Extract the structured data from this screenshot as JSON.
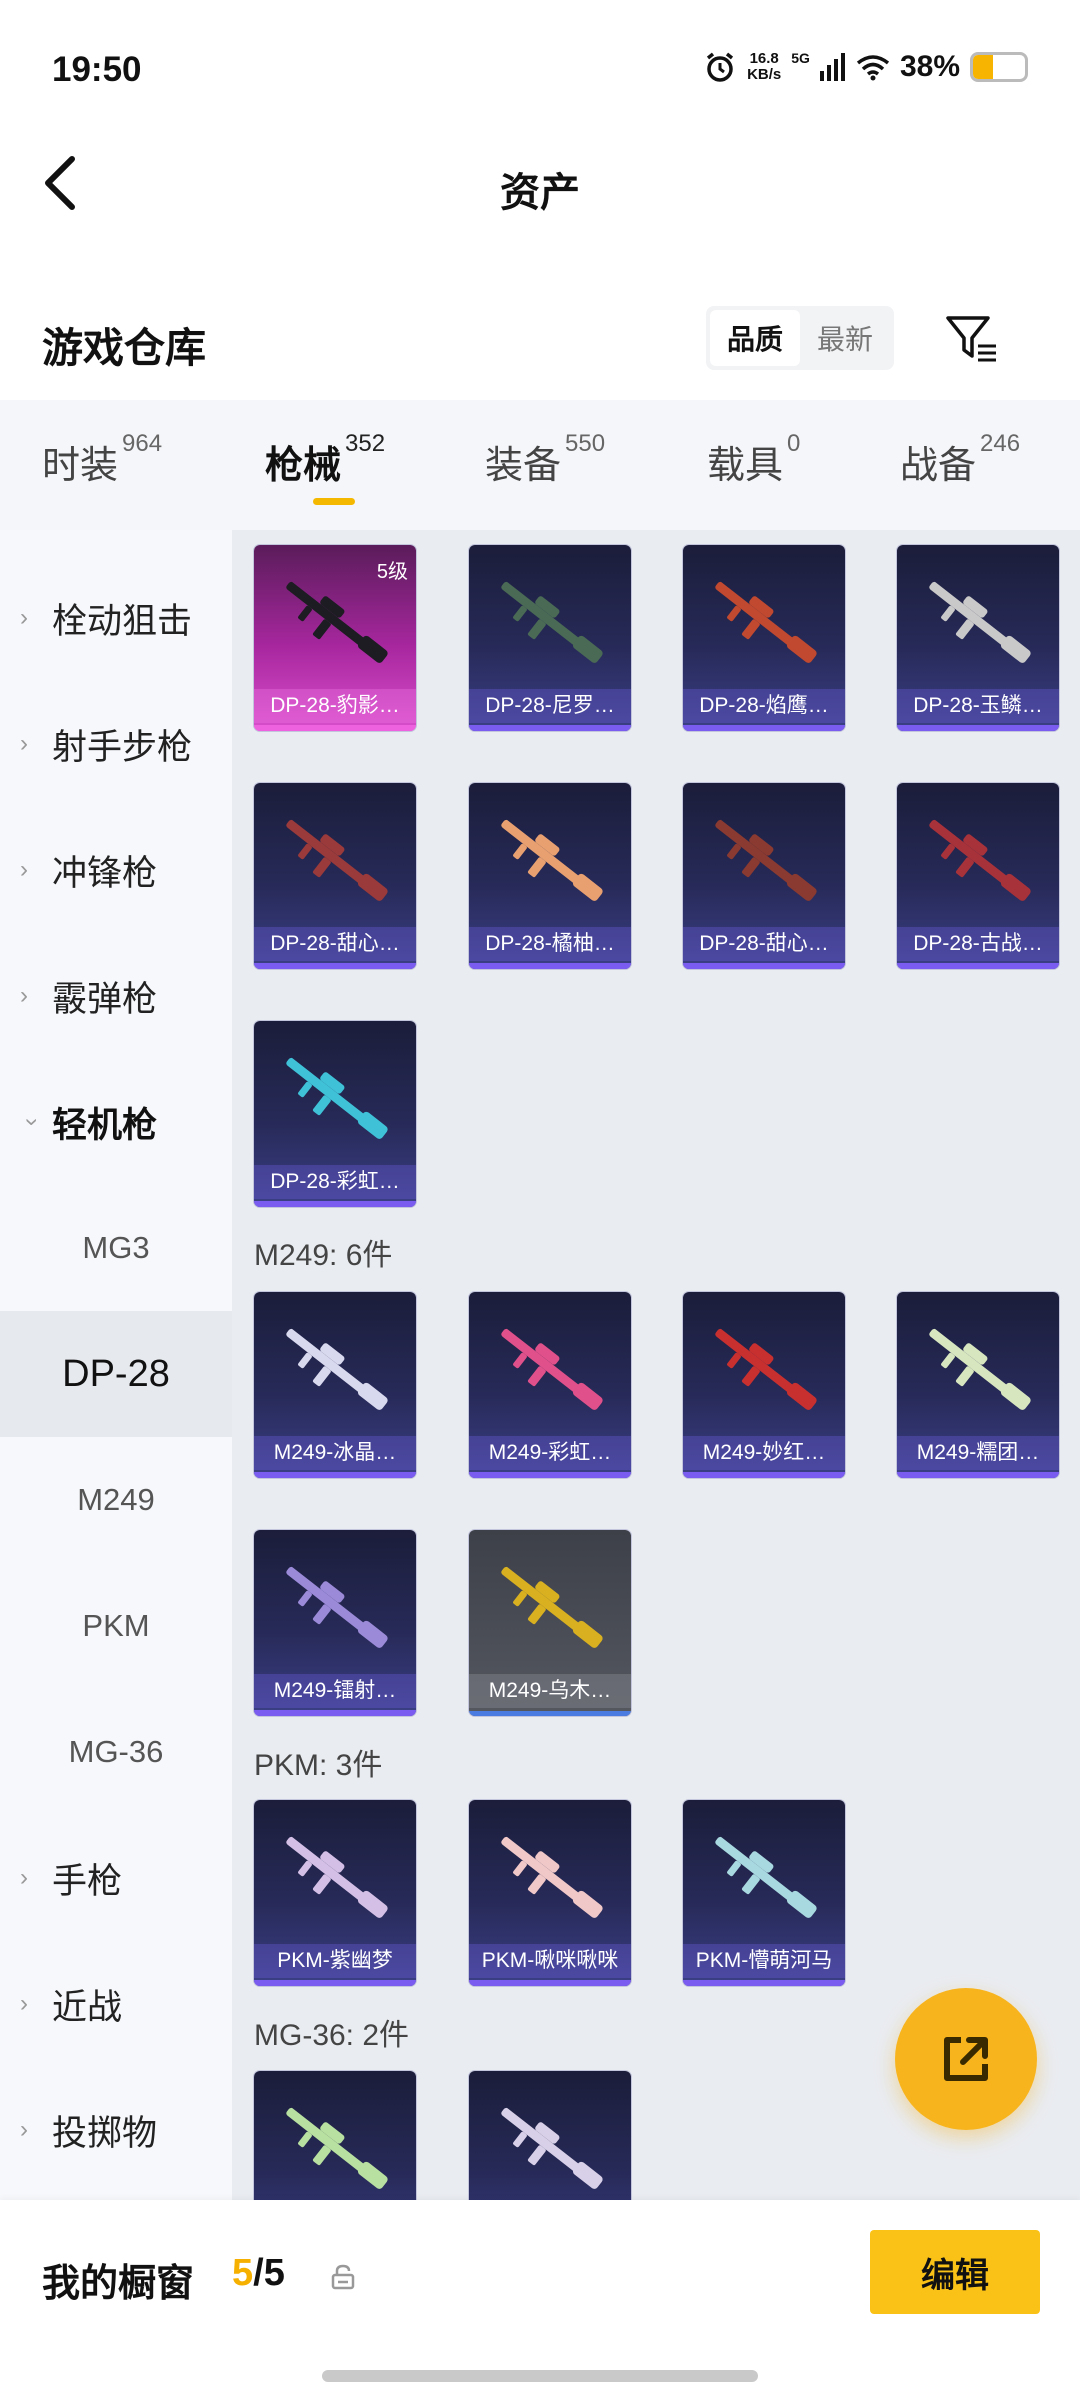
{
  "status_bar": {
    "time": "19:50",
    "speed_value": "16.8",
    "speed_unit": "KB/s",
    "network": "5G",
    "battery_percent": "38%",
    "battery_level": 0.38
  },
  "header": {
    "title": "资产"
  },
  "warehouse": {
    "title": "游戏仓库",
    "sort_options": [
      "品质",
      "最新"
    ],
    "sort_selected": "品质"
  },
  "tabs": [
    {
      "label": "时装",
      "count": "964"
    },
    {
      "label": "枪械",
      "count": "352",
      "active": true
    },
    {
      "label": "装备",
      "count": "550"
    },
    {
      "label": "载具",
      "count": "0"
    },
    {
      "label": "战备",
      "count": "246"
    }
  ],
  "sidebar": {
    "categories": [
      {
        "label": "栓动狙击"
      },
      {
        "label": "射手步枪"
      },
      {
        "label": "冲锋枪"
      },
      {
        "label": "霰弹枪"
      },
      {
        "label": "轻机枪",
        "expanded": true
      }
    ],
    "subitems": [
      {
        "label": "MG3"
      },
      {
        "label": "DP-28",
        "active": true
      },
      {
        "label": "M249"
      },
      {
        "label": "PKM"
      },
      {
        "label": "MG-36"
      }
    ],
    "more_categories": [
      {
        "label": "手枪"
      },
      {
        "label": "近战"
      },
      {
        "label": "投掷物"
      }
    ]
  },
  "groups": [
    {
      "heading": "",
      "items": [
        {
          "name": "DP-28-豹影…",
          "badge": "5级",
          "style": "pink",
          "gun_color": "#1c1c22"
        },
        {
          "name": "DP-28-尼罗…",
          "style": "purple",
          "gun_color": "#4a6a55"
        },
        {
          "name": "DP-28-焰鹰…",
          "style": "purple",
          "gun_color": "#c0492f"
        },
        {
          "name": "DP-28-玉鳞…",
          "style": "purple",
          "gun_color": "#c9c9c9"
        },
        {
          "name": "DP-28-甜心…",
          "style": "purple",
          "gun_color": "#9a3a3a"
        },
        {
          "name": "DP-28-橘柚…",
          "style": "purple",
          "gun_color": "#e8a070"
        },
        {
          "name": "DP-28-甜心…",
          "style": "purple",
          "gun_color": "#8a3a30"
        },
        {
          "name": "DP-28-古战…",
          "style": "purple",
          "gun_color": "#a8323a"
        },
        {
          "name": "DP-28-彩虹…",
          "style": "purple",
          "gun_color": "#3fc2d8"
        }
      ]
    },
    {
      "heading": "M249: 6件",
      "items": [
        {
          "name": "M249-冰晶…",
          "style": "purple",
          "gun_color": "#d8d8ee"
        },
        {
          "name": "M249-彩虹…",
          "style": "purple",
          "gun_color": "#e0508a"
        },
        {
          "name": "M249-妙红…",
          "style": "purple",
          "gun_color": "#c83030"
        },
        {
          "name": "M249-糯团…",
          "style": "purple",
          "gun_color": "#d8e6c0"
        },
        {
          "name": "M249-镭射…",
          "style": "purple",
          "gun_color": "#9a8ad8"
        },
        {
          "name": "M249-乌木…",
          "style": "grey",
          "gun_color": "#d8b020"
        }
      ]
    },
    {
      "heading": "PKM: 3件",
      "items": [
        {
          "name": "PKM-紫幽梦",
          "style": "purple",
          "gun_color": "#d4c0e6"
        },
        {
          "name": "PKM-啾咪啾咪",
          "style": "purple",
          "gun_color": "#f0c8c8"
        },
        {
          "name": "PKM-懵萌河马",
          "style": "purple",
          "gun_color": "#a8d8e0"
        }
      ]
    },
    {
      "heading": "MG-36: 2件",
      "items": [
        {
          "name": "",
          "style": "purple",
          "gun_color": "#b8e0a0"
        },
        {
          "name": "",
          "style": "purple",
          "gun_color": "#d8d0e8"
        }
      ]
    }
  ],
  "bottom": {
    "showcase_label": "我的橱窗",
    "showcase_current": "5",
    "showcase_separator": "/",
    "showcase_total": "5",
    "edit_label": "编辑"
  },
  "colors": {
    "accent": "#f5b800",
    "fab": "#f8b41c",
    "edit_button": "#fac216"
  },
  "icons": [
    "back-arrow-icon",
    "filter-icon",
    "alarm-icon",
    "signal-icon",
    "wifi-icon",
    "battery-icon",
    "chevron-right-icon",
    "chevron-down-icon",
    "share-external-icon",
    "lock-icon"
  ]
}
